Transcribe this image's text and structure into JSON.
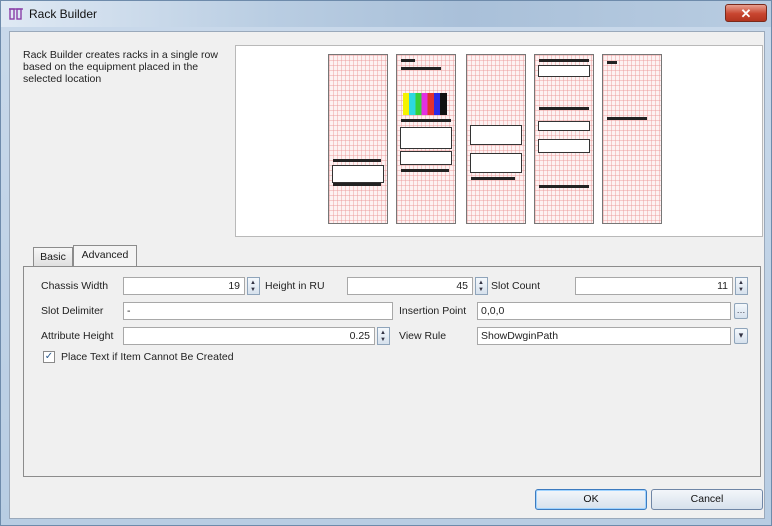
{
  "window": {
    "title": "Rack Builder",
    "close_glyph": "✕"
  },
  "description": "Rack Builder  creates racks in a single row based on the equipment placed in the selected location",
  "tabs": [
    {
      "label": "Basic",
      "selected": false
    },
    {
      "label": "Advanced",
      "selected": true
    }
  ],
  "fields": {
    "chassis_width": {
      "label": "Chassis Width",
      "value": "19"
    },
    "height_in_ru": {
      "label": "Height in RU",
      "value": "45"
    },
    "slot_count": {
      "label": "Slot Count",
      "value": "11"
    },
    "slot_delimiter": {
      "label": "Slot Delimiter",
      "value": "-"
    },
    "insertion_point": {
      "label": "Insertion Point",
      "value": "0,0,0"
    },
    "attribute_height": {
      "label": "Attribute Height",
      "value": "0.25"
    },
    "view_rule": {
      "label": "View Rule",
      "value": "ShowDwginPath"
    }
  },
  "place_text_checkbox": {
    "label": "Place Text if Item Cannot Be Created",
    "checked": true,
    "glyph": "✓"
  },
  "buttons": {
    "ok": "OK",
    "cancel": "Cancel"
  },
  "icons": {
    "browse": "…",
    "dropdown": "▾",
    "spin_up": "▲",
    "spin_down": "▼"
  },
  "colors": {
    "title_gradient_end": "#a9c0d9",
    "close_button": "#c8452f",
    "rack_grid": "#eb9696"
  }
}
